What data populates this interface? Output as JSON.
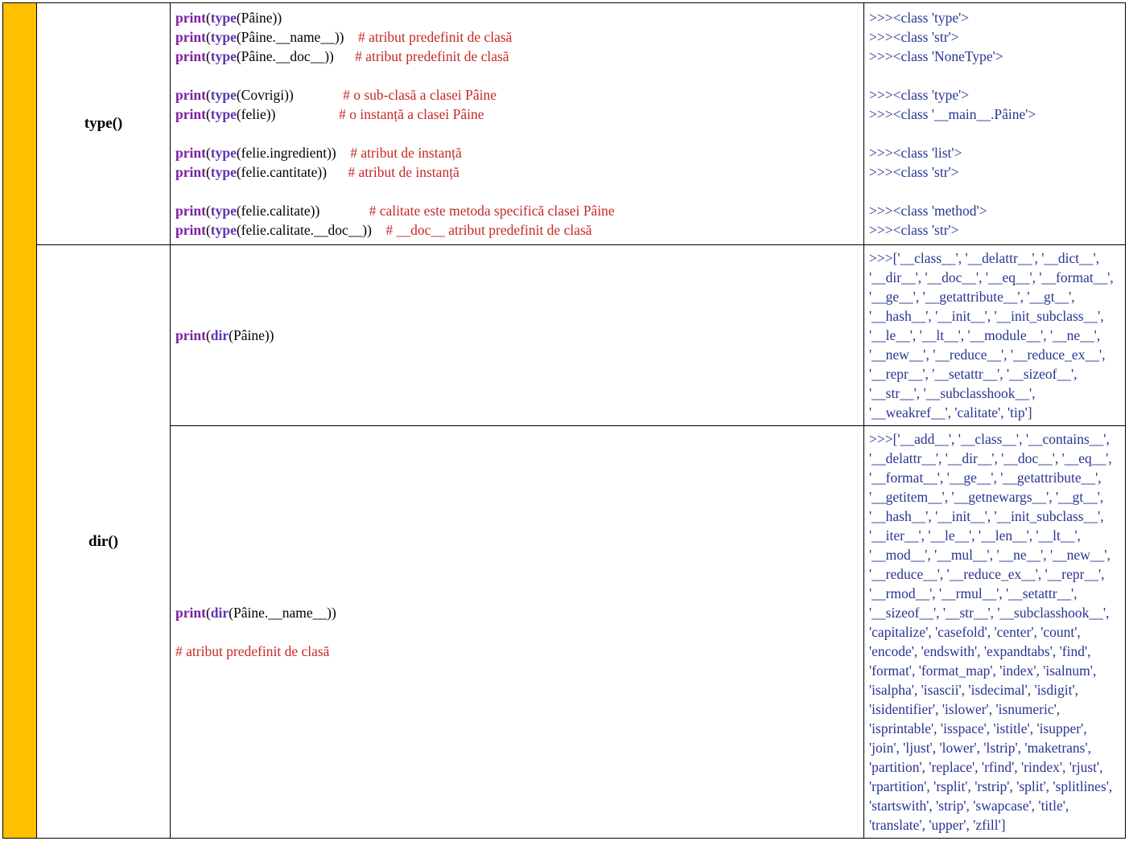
{
  "functions": {
    "type": "type()",
    "dir": "dir()"
  },
  "type_row": {
    "code_lines": [
      [
        {
          "t": "kw",
          "v": "print"
        },
        {
          "t": "blk",
          "v": "("
        },
        {
          "t": "built",
          "v": "type"
        },
        {
          "t": "blk",
          "v": "(Pâine))"
        }
      ],
      [
        {
          "t": "kw",
          "v": "print"
        },
        {
          "t": "blk",
          "v": "("
        },
        {
          "t": "built",
          "v": "type"
        },
        {
          "t": "blk",
          "v": "(Pâine.__name__))"
        },
        {
          "t": "pad",
          "v": "    "
        },
        {
          "t": "comment",
          "v": "# atribut predefinit de clasă"
        }
      ],
      [
        {
          "t": "kw",
          "v": "print"
        },
        {
          "t": "blk",
          "v": "("
        },
        {
          "t": "built",
          "v": "type"
        },
        {
          "t": "blk",
          "v": "(Pâine.__doc__))"
        },
        {
          "t": "pad",
          "v": "      "
        },
        {
          "t": "comment",
          "v": "# atribut predefinit de clasă"
        }
      ],
      [
        {
          "t": "blank",
          "v": ""
        }
      ],
      [
        {
          "t": "kw",
          "v": "print"
        },
        {
          "t": "blk",
          "v": "("
        },
        {
          "t": "built",
          "v": "type"
        },
        {
          "t": "blk",
          "v": "(Covrigi))"
        },
        {
          "t": "pad",
          "v": "              "
        },
        {
          "t": "comment",
          "v": "# o sub-clasă a clasei Pâine"
        }
      ],
      [
        {
          "t": "kw",
          "v": "print"
        },
        {
          "t": "blk",
          "v": "("
        },
        {
          "t": "built",
          "v": "type"
        },
        {
          "t": "blk",
          "v": "(felie))"
        },
        {
          "t": "pad",
          "v": "                  "
        },
        {
          "t": "comment",
          "v": "# o instanță a clasei Pâine"
        }
      ],
      [
        {
          "t": "blank",
          "v": ""
        }
      ],
      [
        {
          "t": "kw",
          "v": "print"
        },
        {
          "t": "blk",
          "v": "("
        },
        {
          "t": "built",
          "v": "type"
        },
        {
          "t": "blk",
          "v": "(felie.ingredient))"
        },
        {
          "t": "pad",
          "v": "    "
        },
        {
          "t": "comment",
          "v": "# atribut de instanță"
        }
      ],
      [
        {
          "t": "kw",
          "v": "print"
        },
        {
          "t": "blk",
          "v": "("
        },
        {
          "t": "built",
          "v": "type"
        },
        {
          "t": "blk",
          "v": "(felie.cantitate))"
        },
        {
          "t": "pad",
          "v": "      "
        },
        {
          "t": "comment",
          "v": "# atribut de instanță"
        }
      ],
      [
        {
          "t": "blank",
          "v": ""
        }
      ],
      [
        {
          "t": "kw",
          "v": "print"
        },
        {
          "t": "blk",
          "v": "("
        },
        {
          "t": "built",
          "v": "type"
        },
        {
          "t": "blk",
          "v": "(felie.calitate))"
        },
        {
          "t": "pad",
          "v": "              "
        },
        {
          "t": "comment",
          "v": "# calitate este metoda specifică clasei Pâine"
        }
      ],
      [
        {
          "t": "kw",
          "v": "print"
        },
        {
          "t": "blk",
          "v": "("
        },
        {
          "t": "built",
          "v": "type"
        },
        {
          "t": "blk",
          "v": "(felie.calitate.__doc__))"
        },
        {
          "t": "pad",
          "v": "    "
        },
        {
          "t": "comment",
          "v": "# __doc__ atribut predefinit de clasă"
        }
      ]
    ],
    "output_lines": [
      ">>><class 'type'>",
      ">>><class 'str'>",
      ">>><class 'NoneType'>",
      "",
      ">>><class 'type'>",
      ">>><class '__main__.Pâine'>",
      "",
      ">>><class 'list'>",
      ">>><class 'str'>",
      "",
      ">>><class 'method'>",
      ">>><class 'str'>"
    ]
  },
  "dir_rows": [
    {
      "code_lines": [
        [
          {
            "t": "kw",
            "v": "print"
          },
          {
            "t": "blk",
            "v": "("
          },
          {
            "t": "built",
            "v": "dir"
          },
          {
            "t": "blk",
            "v": "(Pâine))"
          }
        ]
      ],
      "output": ">>>['__class__', '__delattr__', '__dict__', '__dir__', '__doc__', '__eq__', '__format__', '__ge__', '__getattribute__', '__gt__', '__hash__', '__init__', '__init_subclass__', '__le__', '__lt__', '__module__', '__ne__', '__new__', '__reduce__', '__reduce_ex__', '__repr__', '__setattr__', '__sizeof__', '__str__', '__subclasshook__', '__weakref__', 'calitate', 'tip']"
    },
    {
      "code_lines": [
        [
          {
            "t": "kw",
            "v": "print"
          },
          {
            "t": "blk",
            "v": "("
          },
          {
            "t": "built",
            "v": "dir"
          },
          {
            "t": "blk",
            "v": "(Pâine.__name__))"
          }
        ],
        [
          {
            "t": "blank",
            "v": ""
          }
        ],
        [
          {
            "t": "comment",
            "v": "# atribut predefinit de clasă"
          }
        ]
      ],
      "output": ">>>['__add__', '__class__', '__contains__', '__delattr__', '__dir__', '__doc__', '__eq__', '__format__', '__ge__', '__getattribute__', '__getitem__', '__getnewargs__', '__gt__', '__hash__', '__init__', '__init_subclass__', '__iter__', '__le__', '__len__', '__lt__', '__mod__', '__mul__', '__ne__', '__new__', '__reduce__', '__reduce_ex__', '__repr__', '__rmod__', '__rmul__', '__setattr__', '__sizeof__', '__str__', '__subclasshook__', 'capitalize', 'casefold', 'center', 'count', 'encode', 'endswith', 'expandtabs', 'find', 'format', 'format_map', 'index', 'isalnum', 'isalpha', 'isascii', 'isdecimal', 'isdigit', 'isidentifier', 'islower', 'isnumeric', 'isprintable', 'isspace', 'istitle', 'isupper', 'join', 'ljust', 'lower', 'lstrip', 'maketrans', 'partition', 'replace', 'rfind', 'rindex', 'rjust', 'rpartition', 'rsplit', 'rstrip', 'split', 'splitlines', 'startswith', 'strip', 'swapcase', 'title', 'translate', 'upper', 'zfill']"
    }
  ]
}
